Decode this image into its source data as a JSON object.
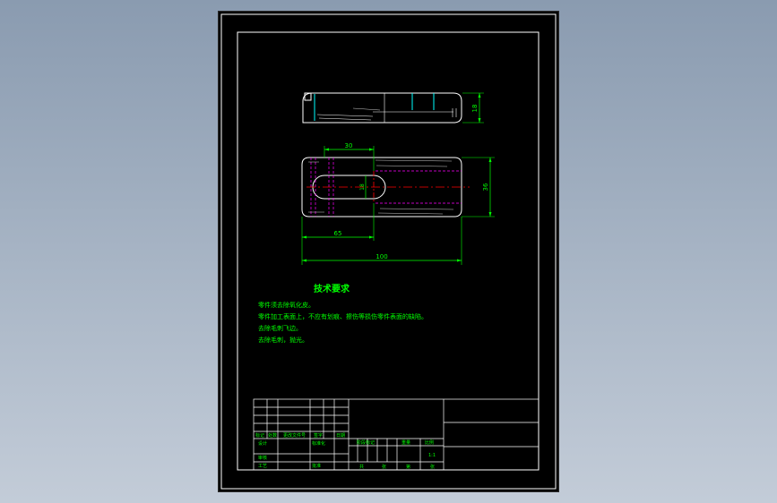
{
  "colors": {
    "background": "#8a9bb0",
    "sheet": "#000000",
    "frame": "#ffffff",
    "dimension": "#00ff00",
    "centerline": "#ff0000",
    "hidden": "#ff00ff",
    "text": "#00ff00"
  },
  "dimensions": {
    "thickness": "18",
    "slot_offset": "30",
    "slot_width": "18",
    "width": "36",
    "slot_length": "65",
    "overall_length": "100"
  },
  "notes": {
    "title": "技术要求",
    "items": [
      "零件须去除氧化皮。",
      "零件加工表面上，不应有划痕、擦伤等损伤零件表面的缺陷。",
      "去除毛刺飞边。",
      "去除毛刺，抛光。"
    ]
  },
  "title_block": {
    "row_labels": [
      "标记",
      "处数",
      "更改文件号",
      "签字",
      "日期"
    ],
    "design_label": "设计",
    "standard_label": "标准化",
    "stage_label": "阶段标记",
    "weight_label": "重量",
    "scale_label": "比例",
    "scale_value": "1:1",
    "review_label": "审核",
    "process_label": "工艺",
    "approve_label": "批准",
    "sheet_total_label": "共",
    "sheet_label": "张",
    "page_label": "第",
    "page_sheet_label": "张"
  }
}
